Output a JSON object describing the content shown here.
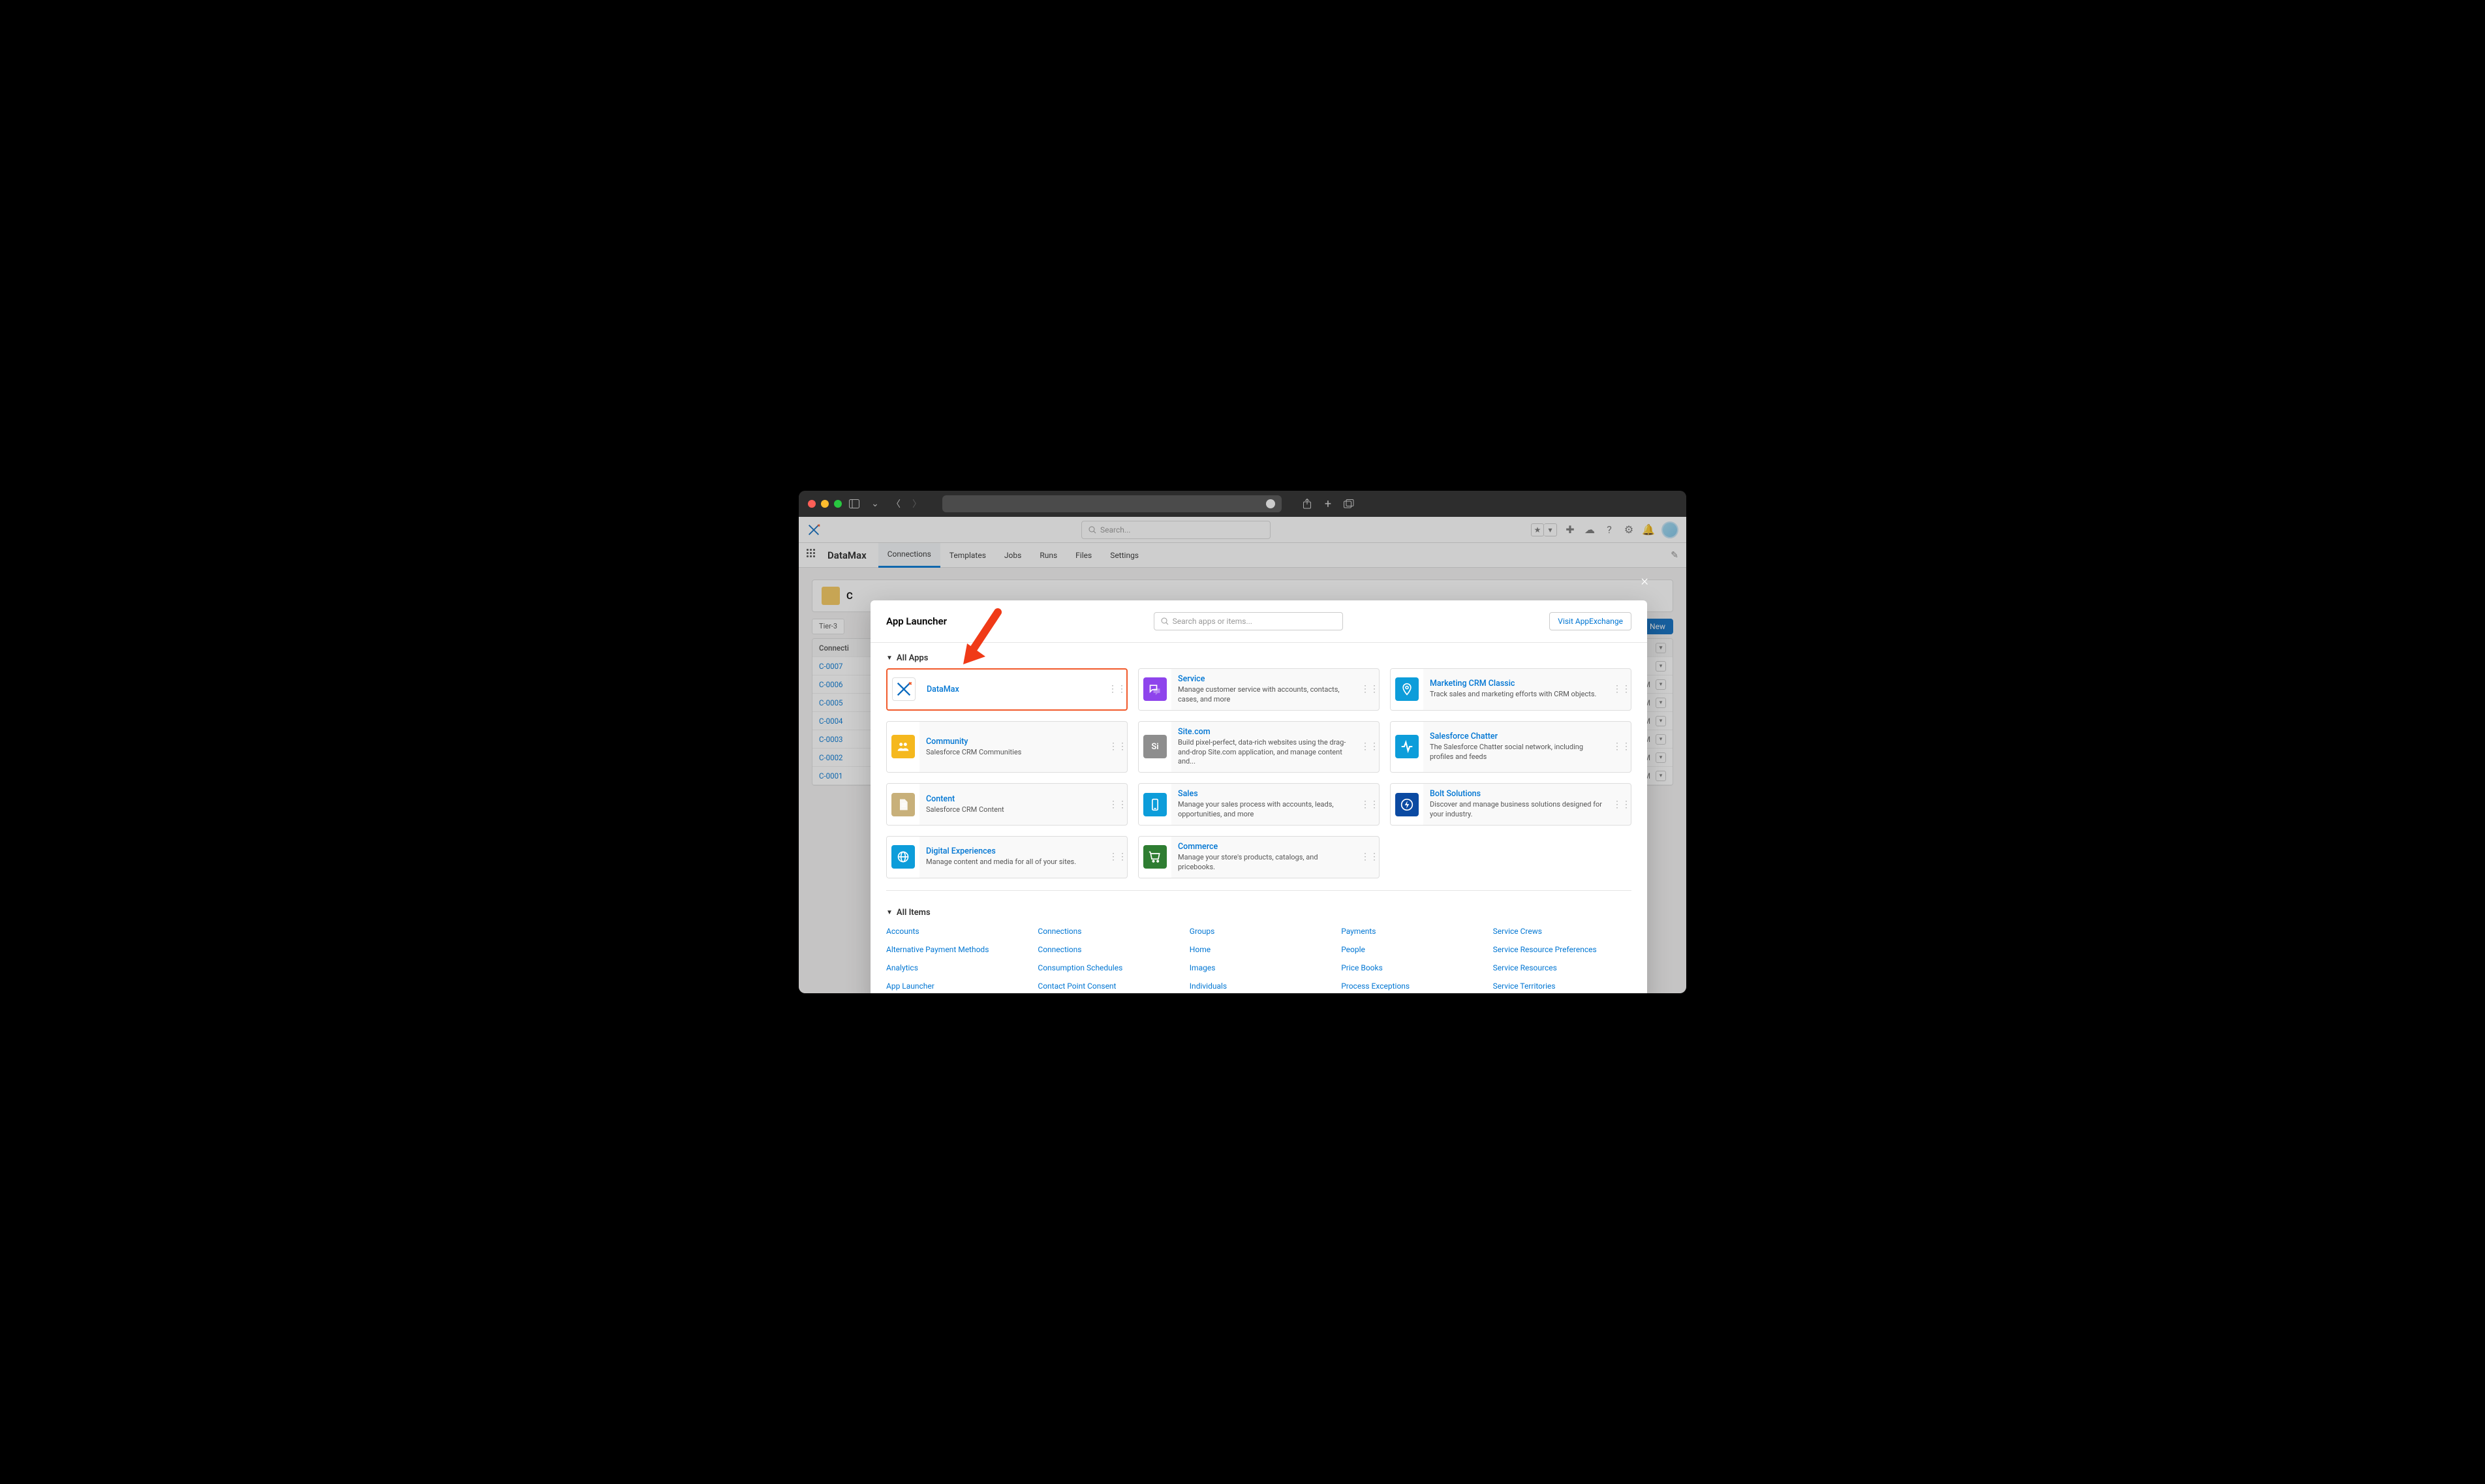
{
  "titlebar": {},
  "header": {
    "search_placeholder": "Search...",
    "app_name": "DataMax",
    "tabs": [
      "Connections",
      "Templates",
      "Jobs",
      "Runs",
      "Files",
      "Settings"
    ]
  },
  "behind": {
    "page_title_partial": "C",
    "tier_pill": "Tier-3",
    "new_label": "New",
    "col_header": "Connecti",
    "rows": [
      {
        "id": "C-0007",
        "right": ""
      },
      {
        "id": "C-0006",
        "right": "M"
      },
      {
        "id": "C-0005",
        "right": "M"
      },
      {
        "id": "C-0004",
        "right": "M"
      },
      {
        "id": "C-0003",
        "right": "M"
      },
      {
        "id": "C-0002",
        "right": "M"
      },
      {
        "id": "C-0001",
        "right": "M"
      }
    ]
  },
  "modal": {
    "title": "App Launcher",
    "search_placeholder": "Search apps or items...",
    "exchange_btn": "Visit AppExchange",
    "all_apps_label": "All Apps",
    "all_items_label": "All Items",
    "apps": [
      {
        "title": "DataMax",
        "desc": "",
        "color": "#ffffff",
        "highlighted": true,
        "icon": "datamax"
      },
      {
        "title": "Service",
        "desc": "Manage customer service with accounts, contacts, cases, and more",
        "color": "#8e44ec",
        "icon": "chat"
      },
      {
        "title": "Marketing CRM Classic",
        "desc": "Track sales and marketing efforts with CRM objects.",
        "color": "#0d9dda",
        "icon": "pin"
      },
      {
        "title": "Community",
        "desc": "Salesforce CRM Communities",
        "color": "#f5b81e",
        "icon": "people"
      },
      {
        "title": "Site.com",
        "desc": "Build pixel-perfect, data-rich websites using the drag-and-drop Site.com application, and manage content and...",
        "color": "#8e8e8e",
        "icon": "Si",
        "text_icon": true
      },
      {
        "title": "Salesforce Chatter",
        "desc": "The Salesforce Chatter social network, including profiles and feeds",
        "color": "#0d9dda",
        "icon": "pulse"
      },
      {
        "title": "Content",
        "desc": "Salesforce CRM Content",
        "color": "#c8b07a",
        "icon": "doc"
      },
      {
        "title": "Sales",
        "desc": "Manage your sales process with accounts, leads, opportunities, and more",
        "color": "#0d9dda",
        "icon": "phone"
      },
      {
        "title": "Bolt Solutions",
        "desc": "Discover and manage business solutions designed for your industry.",
        "color": "#0b4aa2",
        "icon": "bolt"
      },
      {
        "title": "Digital Experiences",
        "desc": "Manage content and media for all of your sites.",
        "color": "#0d9dda",
        "icon": "globe"
      },
      {
        "title": "Commerce",
        "desc": "Manage your store's products, catalogs, and pricebooks.",
        "color": "#2e7d32",
        "icon": "cart"
      }
    ],
    "items": [
      [
        "Accounts",
        "Connections",
        "Groups",
        "Payments",
        "Service Crews"
      ],
      [
        "Alternative Payment Methods",
        "Connections",
        "Home",
        "People",
        "Service Resource Preferences"
      ],
      [
        "Analytics",
        "Consumption Schedules",
        "Images",
        "Price Books",
        "Service Resources"
      ],
      [
        "App Launcher",
        "Contact Point Consent",
        "Individuals",
        "Process Exceptions",
        "Service Territories"
      ]
    ]
  }
}
